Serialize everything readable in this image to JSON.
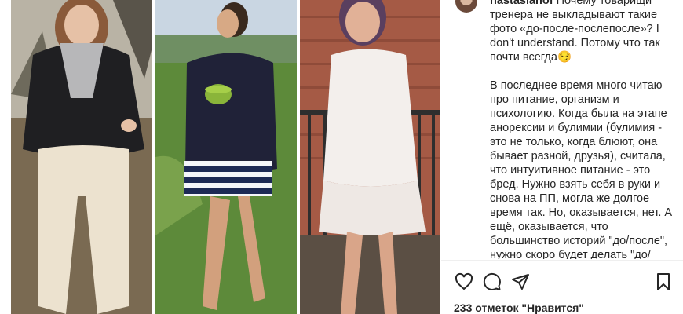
{
  "post": {
    "username": "nastasianof",
    "caption": " Почему товарищи тренера не выкладывают такие фото «до-после-послепосле»? I don't understand. Потому что так почти всегда😏\n\nВ последнее время много читаю про питание, организм и психологию. Когда была на этапе анорексии и булимии (булимия - это не только, когда блюют, она бывает разной, друзья), считала, что интуитивное питание - это бред. Нужно взять себя в руки и снова на ПП, могла же долгое время так. Но, оказывается, нет. А ещё, оказывается, что большинство историй \"до/после\", нужно скоро будет делать \"до/после/послепосле\" потому что приходит следующий этап у",
    "likes_text": "233 отметок \"Нравится\""
  },
  "icons": {
    "like": "heart-icon",
    "comment": "comment-icon",
    "share": "share-icon",
    "save": "bookmark-icon"
  }
}
